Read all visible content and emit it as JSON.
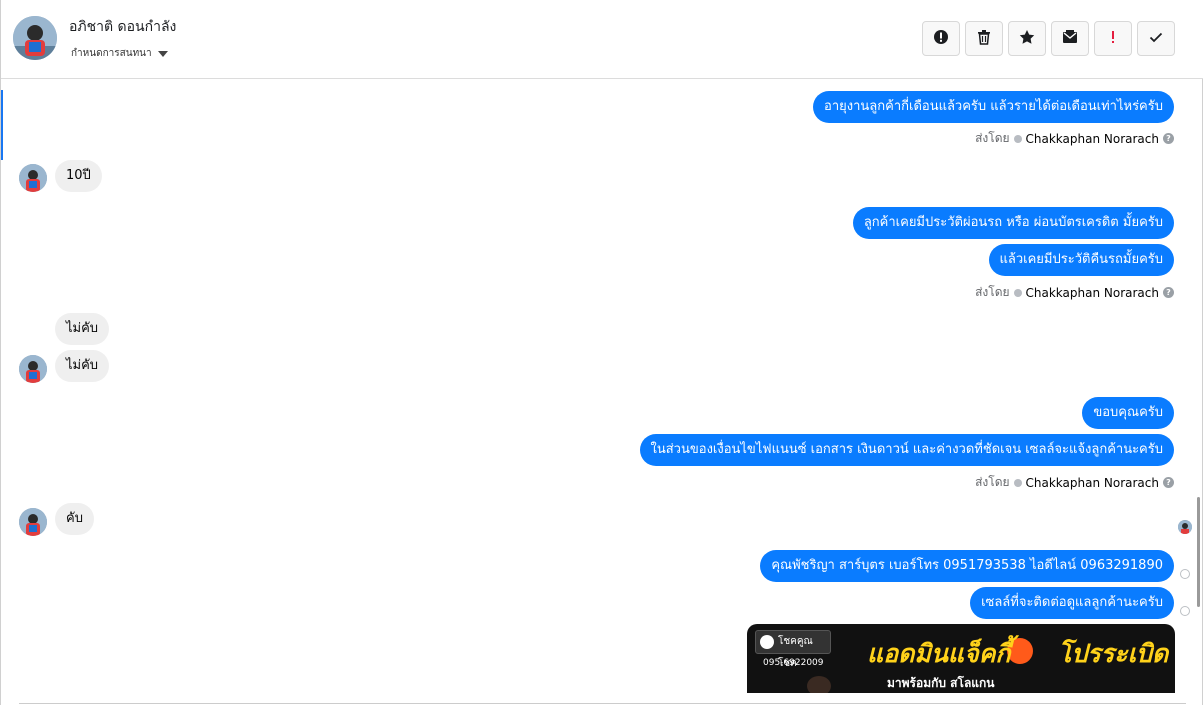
{
  "header": {
    "contact_name": "อภิชาติ ดอนกำลัง",
    "status_label": "กำหนดการสนทนา",
    "toolbar": [
      {
        "name": "spam-report-button",
        "icon": "alert-circle-icon"
      },
      {
        "name": "delete-button",
        "icon": "trash-icon"
      },
      {
        "name": "star-button",
        "icon": "star-icon"
      },
      {
        "name": "mark-unread-button",
        "icon": "envelope-icon"
      },
      {
        "name": "priority-button",
        "icon": "exclamation-icon"
      },
      {
        "name": "mark-done-button",
        "icon": "check-icon"
      }
    ]
  },
  "messages": {
    "m1": "อายุงานลูกค้ากี่เดือนแล้วครับ แล้วรายได้ต่อเดือนเท่าไหร่ครับ",
    "m2": "10ปี",
    "m3": "ลูกค้าเคยมีประวัติผ่อนรถ หรือ ผ่อนบัตรเครดิต มั้ยครับ",
    "m4": "แล้วเคยมีประวัติคืนรถมั้ยครับ",
    "m5": "ไม่คับ",
    "m6": "ไม่คับ",
    "m7": "ขอบคุณครับ",
    "m8": "ในส่วนของเงื่อนไขไฟแนนซ์ เอกสาร เงินดาวน์ และค่างวดที่ชัดเจน เซลล์จะแจ้งลูกค้านะครับ",
    "m9": "คับ",
    "m10": "คุณพัชริญา สาร์บุตร    เบอร์โทร 0951793538       ไอดีไลน์ 0963291890",
    "m11": "เซลล์ที่จะติดต่อดูแลลูกค้านะครับ"
  },
  "meta": {
    "sent_by_label": "ส่งโดย",
    "agent_name": "Chakkaphan Norarach",
    "help_glyph": "?"
  },
  "banner": {
    "logo_text": "โชคคูณโชค",
    "phone": "095-6922009",
    "title_main": "แอดมินแจ็คกี้",
    "title_accent": "โปรระเบิด",
    "subtitle": "มาพร้อมกับ สโลแกน"
  },
  "colors": {
    "outgoing_bubble": "#0a7cff",
    "incoming_bubble": "#efefef",
    "accent": "#1877f2"
  }
}
